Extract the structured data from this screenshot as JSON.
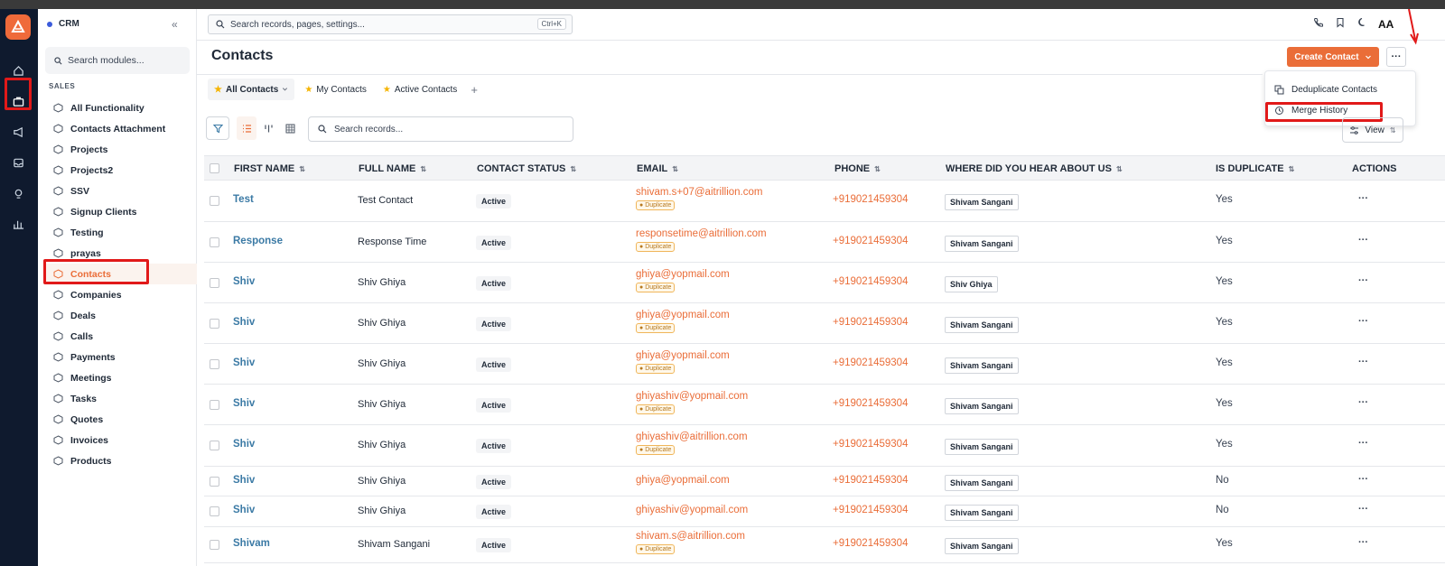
{
  "app": {
    "name": "CRM",
    "collapse_glyph": "«"
  },
  "search_global": {
    "placeholder": "Search records, pages, settings...",
    "shortcut": "Ctrl+K"
  },
  "sidebar": {
    "search_placeholder": "Search modules...",
    "section": "SALES",
    "items": [
      {
        "label": "All Functionality",
        "icon": "cube-icon"
      },
      {
        "label": "Contacts Attachment",
        "icon": "cube-icon"
      },
      {
        "label": "Projects",
        "icon": "cube-icon"
      },
      {
        "label": "Projects2",
        "icon": "cube-icon"
      },
      {
        "label": "SSV",
        "icon": "cube-icon"
      },
      {
        "label": "Signup Clients",
        "icon": "user-icon"
      },
      {
        "label": "Testing",
        "icon": "cube-icon"
      },
      {
        "label": "prayas",
        "icon": "cube-icon"
      },
      {
        "label": "Contacts",
        "icon": "users-icon",
        "active": true
      },
      {
        "label": "Companies",
        "icon": "building-icon"
      },
      {
        "label": "Deals",
        "icon": "handshake-icon"
      },
      {
        "label": "Calls",
        "icon": "phone-icon"
      },
      {
        "label": "Payments",
        "icon": "cube-icon"
      },
      {
        "label": "Meetings",
        "icon": "calendar-icon"
      },
      {
        "label": "Tasks",
        "icon": "checkbox-icon"
      },
      {
        "label": "Quotes",
        "icon": "cube-icon"
      },
      {
        "label": "Invoices",
        "icon": "cube-icon"
      },
      {
        "label": "Products",
        "icon": "cube-icon"
      }
    ]
  },
  "header": {
    "title": "Contacts",
    "create_label": "Create Contact",
    "more_label": "···",
    "avatar_text": "AA"
  },
  "menu": {
    "items": [
      "Deduplicate Contacts",
      "Merge History"
    ]
  },
  "tabs": {
    "items": [
      {
        "label": "All Contacts",
        "active": true
      },
      {
        "label": "My Contacts",
        "active": false
      },
      {
        "label": "Active Contacts",
        "active": false
      }
    ],
    "add_label": "+"
  },
  "toolbar": {
    "search_placeholder": "Search records...",
    "view_label": "View"
  },
  "table": {
    "columns": [
      "FIRST NAME",
      "FULL NAME",
      "CONTACT STATUS",
      "EMAIL",
      "PHONE",
      "WHERE DID YOU HEAR ABOUT US",
      "IS DUPLICATE",
      "ACTIONS"
    ],
    "duplicate_badge": "Duplicate",
    "actions_glyph": "···",
    "rows": [
      {
        "first": "Test",
        "full": "Test Contact",
        "status": "Active",
        "email": "shivam.s+07@aitrillion.com",
        "dup": true,
        "phone": "+919021459304",
        "where": "Shivam Sangani",
        "is_dup": "Yes"
      },
      {
        "first": "Response",
        "full": "Response Time",
        "status": "Active",
        "email": "responsetime@aitrillion.com",
        "dup": true,
        "phone": "+919021459304",
        "where": "Shivam Sangani",
        "is_dup": "Yes"
      },
      {
        "first": "Shiv",
        "full": "Shiv Ghiya",
        "status": "Active",
        "email": "ghiya@yopmail.com",
        "dup": true,
        "phone": "+919021459304",
        "where": "Shiv Ghiya",
        "is_dup": "Yes"
      },
      {
        "first": "Shiv",
        "full": "Shiv Ghiya",
        "status": "Active",
        "email": "ghiya@yopmail.com",
        "dup": true,
        "phone": "+919021459304",
        "where": "Shivam Sangani",
        "is_dup": "Yes"
      },
      {
        "first": "Shiv",
        "full": "Shiv Ghiya",
        "status": "Active",
        "email": "ghiya@yopmail.com",
        "dup": true,
        "phone": "+919021459304",
        "where": "Shivam Sangani",
        "is_dup": "Yes"
      },
      {
        "first": "Shiv",
        "full": "Shiv Ghiya",
        "status": "Active",
        "email": "ghiyashiv@yopmail.com",
        "dup": true,
        "phone": "+919021459304",
        "where": "Shivam Sangani",
        "is_dup": "Yes"
      },
      {
        "first": "Shiv",
        "full": "Shiv Ghiya",
        "status": "Active",
        "email": "ghiyashiv@aitrillion.com",
        "dup": true,
        "phone": "+919021459304",
        "where": "Shivam Sangani",
        "is_dup": "Yes"
      },
      {
        "first": "Shiv",
        "full": "Shiv Ghiya",
        "status": "Active",
        "email": "ghiya@yopmail.com",
        "dup": false,
        "phone": "+919021459304",
        "where": "Shivam Sangani",
        "is_dup": "No"
      },
      {
        "first": "Shiv",
        "full": "Shiv Ghiya",
        "status": "Active",
        "email": "ghiyashiv@yopmail.com",
        "dup": false,
        "phone": "+919021459304",
        "where": "Shivam Sangani",
        "is_dup": "No"
      },
      {
        "first": "Shivam",
        "full": "Shivam Sangani",
        "status": "Active",
        "email": "shivam.s@aitrillion.com",
        "dup": true,
        "phone": "+919021459304",
        "where": "Shivam Sangani",
        "is_dup": "Yes"
      }
    ]
  },
  "colors": {
    "accent": "#ea6d38",
    "link": "#3b7aa5",
    "rail": "#0f1a2e",
    "highlight": "#e11919"
  }
}
